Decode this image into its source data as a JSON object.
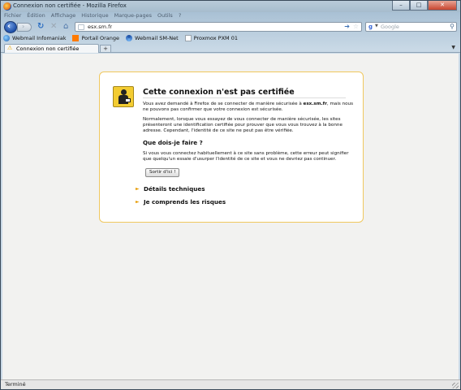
{
  "window": {
    "title": "Connexion non certifiée - Mozilla Firefox",
    "controls": {
      "minimize": "–",
      "maximize": "□",
      "close": "✕"
    }
  },
  "menu": [
    "Fichier",
    "Édition",
    "Affichage",
    "Historique",
    "Marque-pages",
    "Outils",
    "?"
  ],
  "nav": {
    "back_icon": "back-arrow-icon",
    "url": "esx.sm.fr",
    "search_placeholder": "Google"
  },
  "bookmarks": [
    {
      "label": "Webmail Infomaniak",
      "icon": "globe-icon"
    },
    {
      "label": "Portail Orange",
      "icon": "orange-square-icon"
    },
    {
      "label": "Webmail SM-Net",
      "icon": "swirl-icon"
    },
    {
      "label": "Proxmox PXM 01",
      "icon": "page-icon"
    }
  ],
  "tab": {
    "label": "Connexion non certifiée",
    "new_tab": "+"
  },
  "error": {
    "title": "Cette connexion n'est pas certifiée",
    "p1_prefix": "Vous avez demandé à Firefox de se connecter de manière sécurisée à ",
    "p1_host": "esx.sm.fr",
    "p1_suffix": ", mais nous ne pouvons pas confirmer que votre connexion est sécurisée.",
    "p2": "Normalement, lorsque vous essayez de vous connecter de manière sécurisée, les sites présenteront une identification certifiée pour prouver que vous vous trouvez à la bonne adresse. Cependant, l'identité de ce site ne peut pas être vérifiée.",
    "what_title": "Que dois-je faire ?",
    "p3": "Si vous vous connectez habituellement à ce site sans problème, cette erreur peut signifier que quelqu'un essaie d'usurper l'identité de ce site et vous ne devriez pas continuer.",
    "get_out_button": "Sortir d'ici !",
    "details_label": "Détails techniques",
    "risks_label": "Je comprends les risques"
  },
  "status": {
    "text": "Terminé"
  },
  "colors": {
    "warning_yellow": "#f3cc32",
    "box_border": "#f0c85e",
    "arrow": "#e79a00"
  }
}
